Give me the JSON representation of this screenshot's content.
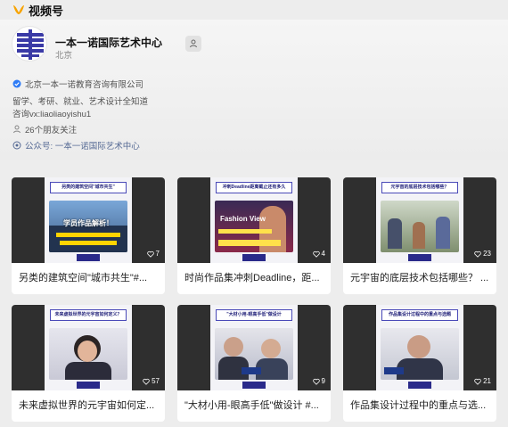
{
  "app": {
    "brand": "视频号"
  },
  "account": {
    "name": "一本一诺国际艺术中心",
    "location": "北京",
    "verification": "北京一本一诺教育咨询有限公司",
    "bio_line1": "留学、考研、就业、艺术设计全知道",
    "bio_line2": "咨询vx:liaoliaoyishu1",
    "friends_following": "26个朋友关注",
    "official_account": "公众号: 一本一诺国际艺术中心"
  },
  "colors": {
    "brand_orange": "#f7a300",
    "link_blue": "#576b95",
    "verified_blue": "#2f7cf6",
    "avatar_navy": "#3a3aa6"
  },
  "videos": [
    {
      "title": "另类的建筑空间\"城市共生\"#...",
      "likes": "7",
      "banner": "另类的建筑空间\"城市共生\"",
      "overlay": "学员作品解析！"
    },
    {
      "title": "时尚作品集冲刺Deadline，距...",
      "likes": "4",
      "banner": "冲刺Deadline距离截止还有多久",
      "overlay": "Fashion View"
    },
    {
      "title": "元宇宙的底层技术包括哪些？ ...",
      "likes": "23",
      "banner": "元宇宙的底层技术包括哪些？",
      "overlay": ""
    },
    {
      "title": "未来虚拟世界的元宇宙如何定...",
      "likes": "57",
      "banner": "未来虚拟世界的元宇宙如何定义？",
      "overlay": ""
    },
    {
      "title": "\"大材小用-眼高手低\"做设计 #...",
      "likes": "9",
      "banner": "\"大材小用-眼高手低\"做设计",
      "overlay": ""
    },
    {
      "title": "作品集设计过程中的重点与选...",
      "likes": "21",
      "banner": "作品集设计过程中的重点与选题",
      "overlay": ""
    }
  ]
}
